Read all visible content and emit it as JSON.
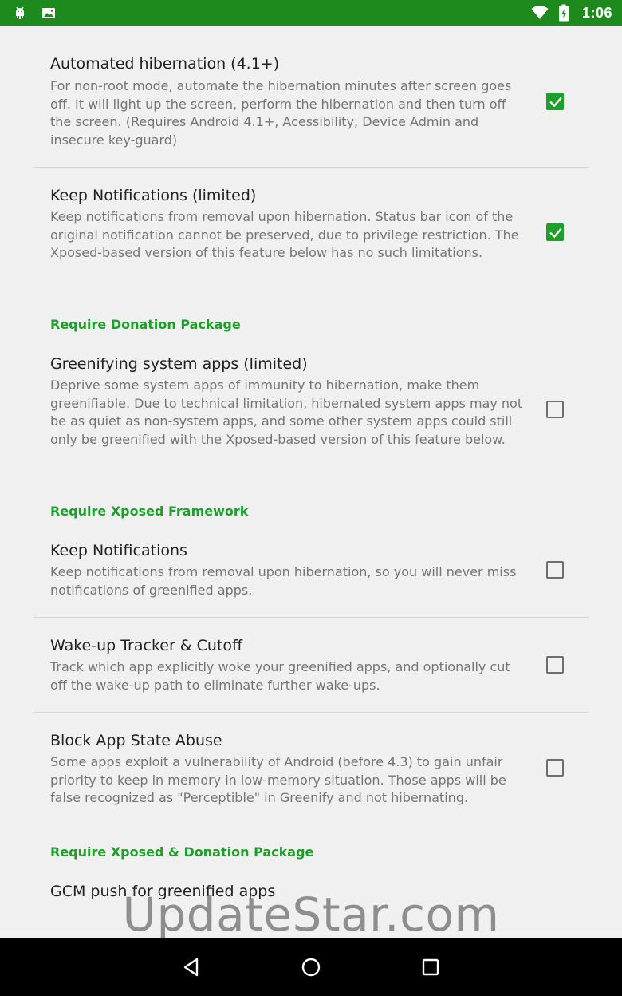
{
  "status_bar": {
    "time": "1:06",
    "left_icons": [
      "android-debug-icon",
      "image-notification-icon"
    ],
    "right_icons": [
      "wifi-icon",
      "battery-charging-icon"
    ]
  },
  "prefs": [
    {
      "title": "Automated hibernation (4.1+)",
      "summary": "For non-root mode, automate the hibernation minutes after screen goes off. It will light up the screen, perform the hibernation and then turn off the screen. (Requires Android 4.1+, Acessibility, Device Admin and insecure key-guard)",
      "checked": true
    },
    {
      "title": "Keep Notifications (limited)",
      "summary": "Keep notifications from removal upon hibernation. Status bar icon of the original notification cannot be preserved, due to privilege restriction. The Xposed-based version of this feature below has no such limitations.",
      "checked": true
    },
    {
      "title": "Greenifying system apps (limited)",
      "summary": "Deprive some system apps of immunity to hibernation, make them greenifiable. Due to technical limitation, hibernated system apps may not be as quiet as non-system apps, and some other system apps could still only be greenified with the Xposed-based version of this feature below.",
      "checked": false
    },
    {
      "title": "Keep Notifications",
      "summary": "Keep notifications from removal upon hibernation, so you will never miss notifications of greenified apps.",
      "checked": false
    },
    {
      "title": "Wake-up Tracker & Cutoff",
      "summary": "Track which app explicitly woke your greenified apps, and optionally cut off the wake-up path to eliminate further wake-ups.",
      "checked": false
    },
    {
      "title": "Block App State Abuse",
      "summary": "Some apps exploit a vulnerability of Android (before 4.3) to gain unfair priority to keep in memory in low-memory situation. Those apps will be false recognized as \"Perceptible\" in Greenify and not hibernating.",
      "checked": false
    },
    {
      "title": "GCM push for greenified apps"
    }
  ],
  "categories": [
    "Require Donation Package",
    "Require Xposed Framework",
    "Require Xposed & Donation Package"
  ],
  "watermark": "UpdateStar.com",
  "colors": {
    "status_bar": "#1e8a1e",
    "accent": "#1e9e2a",
    "background": "#f0f0f0"
  },
  "nav_icons": [
    "back-icon",
    "home-icon",
    "recents-icon"
  ]
}
